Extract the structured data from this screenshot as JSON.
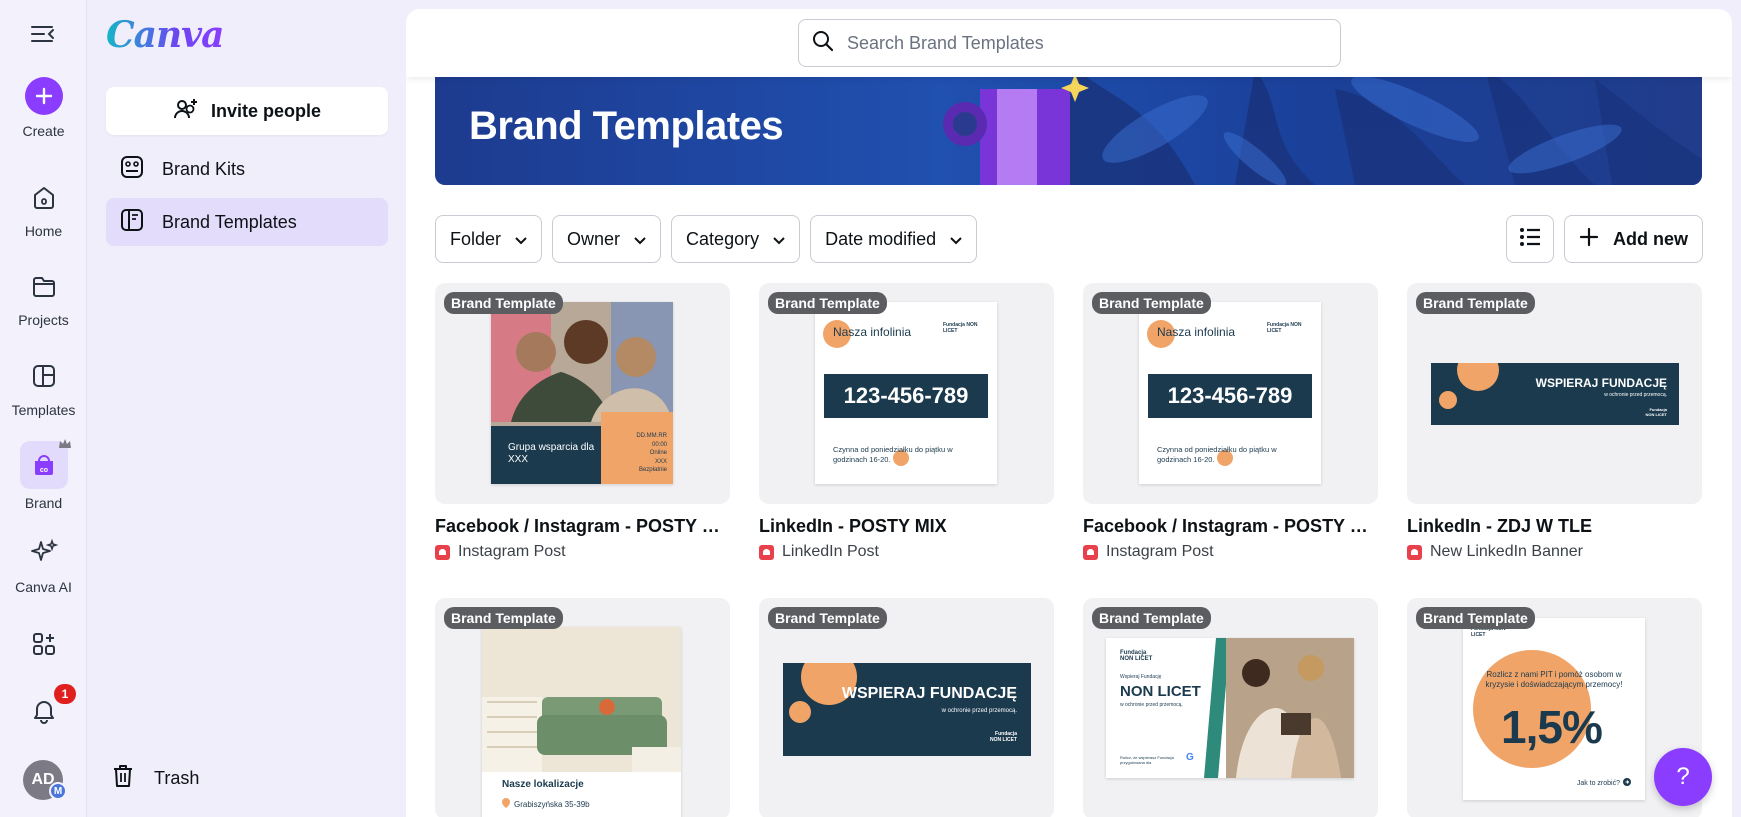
{
  "app": {
    "logo_text": "Canva"
  },
  "rail": {
    "items": [
      {
        "label": "Create"
      },
      {
        "label": "Home"
      },
      {
        "label": "Projects"
      },
      {
        "label": "Templates"
      },
      {
        "label": "Brand"
      },
      {
        "label": "Canva AI"
      }
    ],
    "notification_count": "1",
    "avatar_initials": "AD",
    "avatar_sub": "M"
  },
  "panel": {
    "invite_label": "Invite people",
    "nav": [
      {
        "label": "Brand Kits",
        "icon": "brand-kit-icon"
      },
      {
        "label": "Brand Templates",
        "icon": "brand-templates-icon",
        "active": true
      }
    ],
    "trash_label": "Trash"
  },
  "search": {
    "placeholder": "Search Brand Templates",
    "value": ""
  },
  "hero": {
    "title": "Brand Templates"
  },
  "filters": [
    {
      "label": "Folder"
    },
    {
      "label": "Owner"
    },
    {
      "label": "Category"
    },
    {
      "label": "Date modified"
    }
  ],
  "toolbar": {
    "add_new_label": "Add new"
  },
  "cards": [
    {
      "tag": "Brand Template",
      "title": "Facebook / Instagram - POSTY W...",
      "type": "Instagram Post",
      "thumb_text": {
        "headline": "Grupa wsparcia dla XXX",
        "side": [
          "DD.MM.RR",
          "00:00",
          "Online",
          "XXX",
          "Bezpłatnie"
        ]
      }
    },
    {
      "tag": "Brand Template",
      "title": "LinkedIn - POSTY MIX",
      "type": "LinkedIn Post",
      "thumb_text": {
        "heading": "Nasza infolinia",
        "number": "123-456-789",
        "footer": "Czynna od poniedziałku do piątku w godzinach 16-20.",
        "logo": "Fundacja NON LICET"
      }
    },
    {
      "tag": "Brand Template",
      "title": "Facebook / Instagram - POSTY MIX",
      "type": "Instagram Post",
      "thumb_text": {
        "heading": "Nasza infolinia",
        "number": "123-456-789",
        "footer": "Czynna od poniedziałku do piątku w godzinach 16-20.",
        "logo": "Fundacja NON LICET"
      }
    },
    {
      "tag": "Brand Template",
      "title": "LinkedIn - ZDJ W TLE",
      "type": "New LinkedIn Banner",
      "thumb_text": {
        "headline": "WSPIERAJ FUNDACJĘ",
        "sub": "w ochronie przed przemocą.",
        "logo": "Fundacja NON LICET"
      }
    },
    {
      "tag": "Brand Template",
      "thumb_text": {
        "heading": "Nasze lokalizacje",
        "address": "Grabiszyńska 35-39b"
      }
    },
    {
      "tag": "Brand Template",
      "thumb_text": {
        "headline": "WSPIERAJ FUNDACJĘ",
        "sub": "w ochronie przed przemocą.",
        "logo": "Fundacja NON LICET"
      }
    },
    {
      "tag": "Brand Template",
      "thumb_text": {
        "logo": "Fundacja NON LICET",
        "pre": "Wspieraj Fundację",
        "headline": "NON LICET",
        "sub": "w ochronie przed przemocą.",
        "foot": "Rolicz, że wspierasz Fundacja przygotowana dla"
      }
    },
    {
      "tag": "Brand Template",
      "thumb_text": {
        "logo": "Fundacja NON LICET",
        "body": "Rozlicz z nami PIT i pomóż osobom w kryzysie i doświadczającym przemocy!",
        "big": "1,5%",
        "link": "Jak to zrobić?"
      }
    }
  ],
  "help_label": "?"
}
